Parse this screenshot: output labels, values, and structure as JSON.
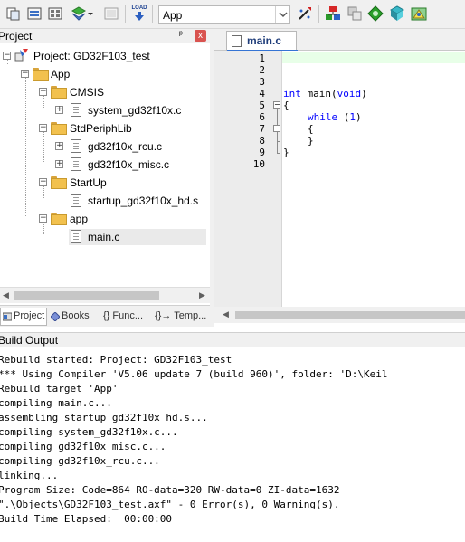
{
  "toolbar": {
    "target_value": "App",
    "icons": [
      "copy-icon",
      "options-icon",
      "manage-icon",
      "component-icon",
      "select-icon",
      "load-icon",
      "target-options-icon",
      "pack-icon",
      "download-icon",
      "debug-icon",
      "settings-icon",
      "pack-installer-icon"
    ],
    "load_label": "LOAD"
  },
  "project_panel": {
    "title": "Project",
    "pin": "ᵖ",
    "close": "x",
    "root": "Project: GD32F103_test",
    "group": "App",
    "tree": [
      {
        "name": "CMSIS",
        "files": [
          "system_gd32f10x.c"
        ]
      },
      {
        "name": "StdPeriphLib",
        "files": [
          "gd32f10x_rcu.c",
          "gd32f10x_misc.c"
        ]
      },
      {
        "name": "StartUp",
        "files": [
          "startup_gd32f10x_hd.s"
        ]
      },
      {
        "name": "app",
        "files": [
          "main.c"
        ]
      }
    ],
    "tabs": [
      "Project",
      "Books",
      "{} Func...",
      "{}→ Temp..."
    ]
  },
  "editor": {
    "tab": "main.c",
    "line_numbers": [
      "1",
      "2",
      "3",
      "4",
      "5",
      "6",
      "7",
      "8",
      "9",
      "10"
    ],
    "code": {
      "l4_type": "int",
      "l4_name": " main(",
      "l4_param": "void",
      "l4_close": ")",
      "l5": "{",
      "l6_kw": "while",
      "l6_rest": " (",
      "l6_num": "1",
      "l6_close": ")",
      "l7": "{",
      "l8": "}",
      "l9": "}"
    }
  },
  "build_output": {
    "title": "Build Output",
    "lines": [
      "Rebuild started: Project: GD32F103_test",
      "*** Using Compiler 'V5.06 update 7 (build 960)', folder: 'D:\\Keil",
      "Rebuild target 'App'",
      "compiling main.c...",
      "assembling startup_gd32f10x_hd.s...",
      "compiling system_gd32f10x.c...",
      "compiling gd32f10x_misc.c...",
      "compiling gd32f10x_rcu.c...",
      "linking...",
      "Program Size: Code=864 RO-data=320 RW-data=0 ZI-data=1632",
      "\".\\Objects\\GD32F103_test.axf\" - 0 Error(s), 0 Warning(s).",
      "Build Time Elapsed:  00:00:00"
    ]
  },
  "colors": {
    "keyword": "#0000ff",
    "current_line": "#e8ffe8",
    "tab_accent": "#3574d4"
  }
}
